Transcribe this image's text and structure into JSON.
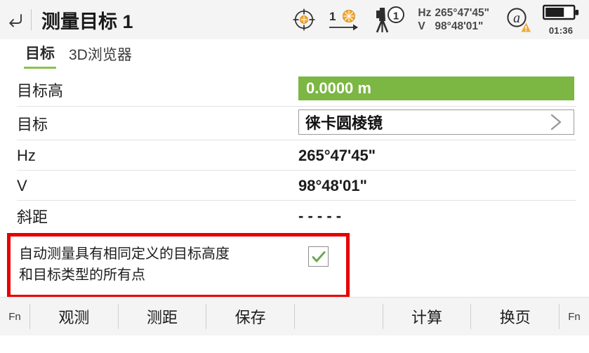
{
  "header": {
    "back_icon": "back-arrow-icon",
    "title": "测量目标 1",
    "status": {
      "target_lock_icon": "target-crosshair-icon",
      "prism_count_icon": "prism-number-icon",
      "prism_count_label": "1",
      "instrument_icon": "total-station-icon",
      "instrument_badge": "1",
      "hz_label": "Hz",
      "hz_value": "265°47'45\"",
      "v_label": "V",
      "v_value": "98°48'01\"",
      "atmosphere_icon": "at-warning-icon",
      "battery_icon": "battery-icon",
      "battery_time": "01:36"
    }
  },
  "tabs": [
    {
      "label": "目标",
      "active": true
    },
    {
      "label": "3D浏览器",
      "active": false
    }
  ],
  "fields": {
    "target_height": {
      "label": "目标高",
      "value": "0.0000 m",
      "accent_color": "#7cb643"
    },
    "target": {
      "label": "目标",
      "value": "徕卡圆棱镜",
      "chevron_icon": "chevron-right-icon"
    },
    "hz": {
      "label": "Hz",
      "value": "265°47'45\""
    },
    "v": {
      "label": "V",
      "value": "98°48'01\""
    },
    "slope_distance": {
      "label": "斜距",
      "value": "- - - - -"
    }
  },
  "auto_measure": {
    "text_line1": "自动测量具有相同定义的目标高度",
    "text_line2": "和目标类型的所有点",
    "checked": true,
    "check_icon": "check-icon",
    "highlight_color": "#e60000"
  },
  "toolbar": {
    "fn_left": "Fn",
    "fn_right": "Fn",
    "buttons": [
      {
        "label": "观测"
      },
      {
        "label": "测距"
      },
      {
        "label": "保存"
      },
      {
        "label": ""
      },
      {
        "label": "计算"
      },
      {
        "label": "换页"
      }
    ]
  }
}
